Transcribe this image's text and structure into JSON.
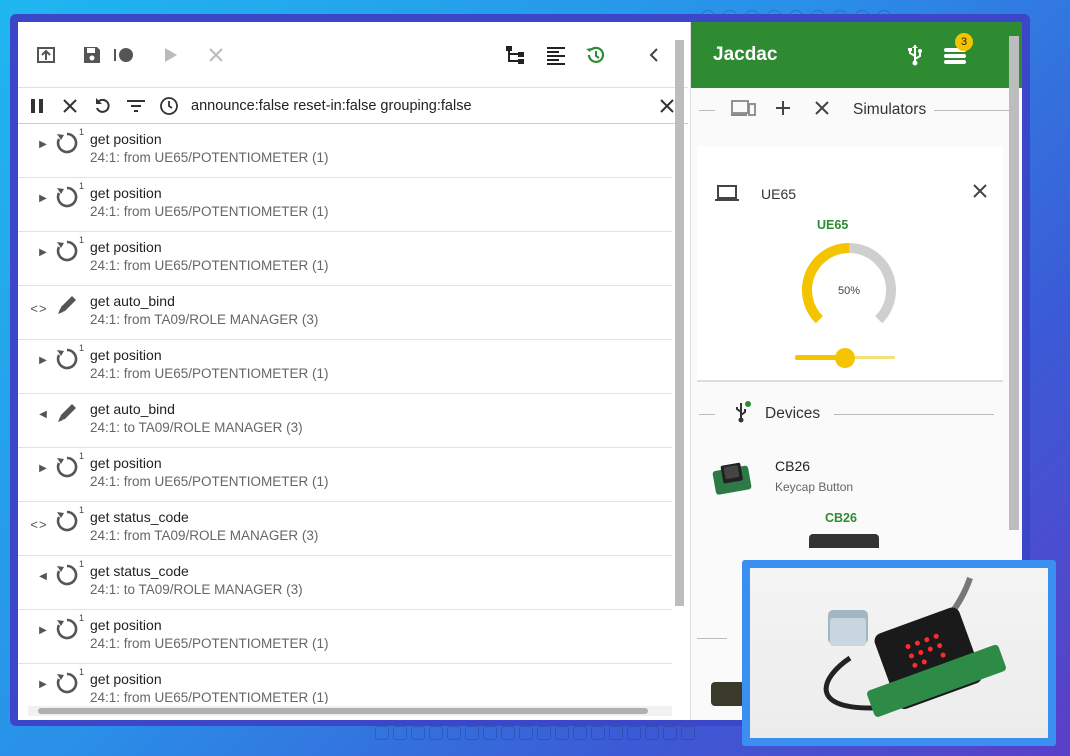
{
  "filter": {
    "query": "announce:false reset-in:false grouping:false"
  },
  "packets": [
    {
      "title": "get position",
      "sub": "24:1: from UE65/POTENTIOMETER (1)",
      "kind": "rotate",
      "dir": "right",
      "count": "1"
    },
    {
      "title": "get position",
      "sub": "24:1: from UE65/POTENTIOMETER (1)",
      "kind": "rotate",
      "dir": "right",
      "count": "1"
    },
    {
      "title": "get position",
      "sub": "24:1: from UE65/POTENTIOMETER (1)",
      "kind": "rotate",
      "dir": "right",
      "count": "1"
    },
    {
      "title": "get auto_bind",
      "sub": "24:1: from TA09/ROLE MANAGER (3)",
      "kind": "pencil",
      "dir": "code",
      "count": ""
    },
    {
      "title": "get position",
      "sub": "24:1: from UE65/POTENTIOMETER (1)",
      "kind": "rotate",
      "dir": "right",
      "count": "1"
    },
    {
      "title": "get auto_bind",
      "sub": "24:1: to TA09/ROLE MANAGER (3)",
      "kind": "pencil",
      "dir": "left",
      "count": ""
    },
    {
      "title": "get position",
      "sub": "24:1: from UE65/POTENTIOMETER (1)",
      "kind": "rotate",
      "dir": "right",
      "count": "1"
    },
    {
      "title": "get status_code",
      "sub": "24:1: from TA09/ROLE MANAGER (3)",
      "kind": "rotate",
      "dir": "code",
      "count": "1"
    },
    {
      "title": "get status_code",
      "sub": "24:1: to TA09/ROLE MANAGER (3)",
      "kind": "rotate",
      "dir": "left",
      "count": "1"
    },
    {
      "title": "get position",
      "sub": "24:1: from UE65/POTENTIOMETER (1)",
      "kind": "rotate",
      "dir": "right",
      "count": "1"
    },
    {
      "title": "get position",
      "sub": "24:1: from UE65/POTENTIOMETER (1)",
      "kind": "rotate",
      "dir": "right",
      "count": "1"
    }
  ],
  "jacdac": {
    "title": "Jacdac",
    "badge": "3",
    "simulators_label": "Simulators",
    "sim_device": "UE65",
    "gauge_label": "UE65",
    "gauge_value": "50%",
    "gauge_fraction": 0.5,
    "slider_fraction": 0.5,
    "devices_label": "Devices",
    "device_name": "CB26",
    "device_desc": "Keycap Button",
    "device_short": "CB26"
  },
  "colors": {
    "accent": "#2e8b31",
    "gauge": "#f5c400",
    "track": "#cfcfcf"
  }
}
